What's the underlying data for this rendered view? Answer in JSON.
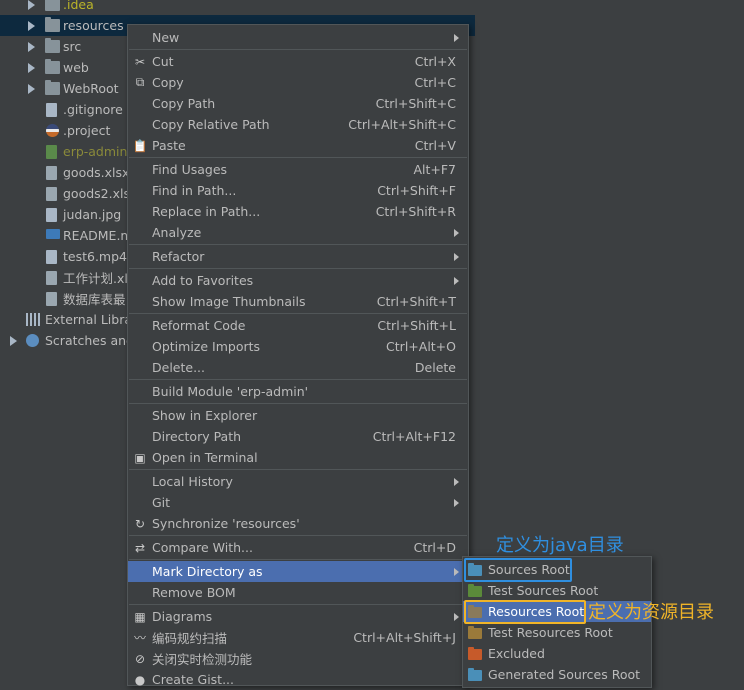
{
  "tree": [
    {
      "label": ".idea",
      "kind": "folder",
      "style": "yellow",
      "arrow": true
    },
    {
      "label": "resources",
      "kind": "folder",
      "style": "normal",
      "arrow": true,
      "selected": true
    },
    {
      "label": "src",
      "kind": "folder",
      "style": "normal",
      "arrow": true
    },
    {
      "label": "web",
      "kind": "folder",
      "style": "normal",
      "arrow": true
    },
    {
      "label": "WebRoot",
      "kind": "folder",
      "style": "normal",
      "arrow": true
    },
    {
      "label": ".gitignore",
      "kind": "file",
      "style": "normal"
    },
    {
      "label": ".project",
      "kind": "circle",
      "style": "normal"
    },
    {
      "label": "erp-admin.",
      "kind": "file-green",
      "style": "olive"
    },
    {
      "label": "goods.xlsx",
      "kind": "file-xls",
      "style": "normal"
    },
    {
      "label": "goods2.xlsx",
      "kind": "file-xls",
      "style": "normal"
    },
    {
      "label": "judan.jpg",
      "kind": "file",
      "style": "normal"
    },
    {
      "label": "README.m",
      "kind": "file-md",
      "style": "normal"
    },
    {
      "label": "test6.mp4",
      "kind": "file",
      "style": "normal"
    },
    {
      "label": "工作计划.xls",
      "kind": "file-xls",
      "style": "normal"
    },
    {
      "label": "数据库表最",
      "kind": "file-xls",
      "style": "normal"
    },
    {
      "label": "External Librar",
      "kind": "bars",
      "style": "normal",
      "top": true
    },
    {
      "label": "Scratches and",
      "kind": "scratch",
      "style": "normal",
      "top": true,
      "arrow": true
    }
  ],
  "menu": [
    {
      "label": "New",
      "shortcut": "",
      "submenu": true
    },
    {
      "sep": true
    },
    {
      "label": "Cut",
      "shortcut": "Ctrl+X",
      "icon": "✂"
    },
    {
      "label": "Copy",
      "shortcut": "Ctrl+C",
      "icon": "⧉"
    },
    {
      "label": "Copy Path",
      "shortcut": "Ctrl+Shift+C"
    },
    {
      "label": "Copy Relative Path",
      "shortcut": "Ctrl+Alt+Shift+C"
    },
    {
      "label": "Paste",
      "shortcut": "Ctrl+V",
      "icon": "📋"
    },
    {
      "sep": true
    },
    {
      "label": "Find Usages",
      "shortcut": "Alt+F7"
    },
    {
      "label": "Find in Path...",
      "shortcut": "Ctrl+Shift+F"
    },
    {
      "label": "Replace in Path...",
      "shortcut": "Ctrl+Shift+R"
    },
    {
      "label": "Analyze",
      "shortcut": "",
      "submenu": true
    },
    {
      "sep": true
    },
    {
      "label": "Refactor",
      "shortcut": "",
      "submenu": true
    },
    {
      "sep": true
    },
    {
      "label": "Add to Favorites",
      "shortcut": "",
      "submenu": true
    },
    {
      "label": "Show Image Thumbnails",
      "shortcut": "Ctrl+Shift+T"
    },
    {
      "sep": true
    },
    {
      "label": "Reformat Code",
      "shortcut": "Ctrl+Shift+L"
    },
    {
      "label": "Optimize Imports",
      "shortcut": "Ctrl+Alt+O"
    },
    {
      "label": "Delete...",
      "shortcut": "Delete"
    },
    {
      "sep": true
    },
    {
      "label": "Build Module 'erp-admin'",
      "shortcut": ""
    },
    {
      "sep": true
    },
    {
      "label": "Show in Explorer",
      "shortcut": ""
    },
    {
      "label": "Directory Path",
      "shortcut": "Ctrl+Alt+F12"
    },
    {
      "label": "Open in Terminal",
      "shortcut": "",
      "icon": "▣"
    },
    {
      "sep": true
    },
    {
      "label": "Local History",
      "shortcut": "",
      "submenu": true
    },
    {
      "label": "Git",
      "shortcut": "",
      "submenu": true
    },
    {
      "label": "Synchronize 'resources'",
      "shortcut": "",
      "icon": "↻"
    },
    {
      "sep": true
    },
    {
      "label": "Compare With...",
      "shortcut": "Ctrl+D",
      "icon": "⇄"
    },
    {
      "sep": true
    },
    {
      "label": "Mark Directory as",
      "shortcut": "",
      "submenu": true,
      "active": true
    },
    {
      "label": "Remove BOM",
      "shortcut": ""
    },
    {
      "sep": true
    },
    {
      "label": "Diagrams",
      "shortcut": "",
      "submenu": true,
      "icon": "▦"
    },
    {
      "label": "编码规约扫描",
      "shortcut": "Ctrl+Alt+Shift+J",
      "icon": "〰"
    },
    {
      "label": "关闭实时检测功能",
      "shortcut": "",
      "icon": "⊘"
    },
    {
      "label": "Create Gist...",
      "shortcut": "",
      "icon": "●"
    }
  ],
  "submenu": [
    {
      "label": "Sources Root",
      "color": "#4a8fb8"
    },
    {
      "label": "Test Sources Root",
      "color": "#5b8a3a"
    },
    {
      "label": "Resources Root",
      "color": "#8a7a5a",
      "active": true
    },
    {
      "label": "Test Resources Root",
      "color": "#9a7a3a"
    },
    {
      "label": "Excluded",
      "color": "#c65a2a"
    },
    {
      "label": "Generated Sources Root",
      "color": "#4a8fb8"
    }
  ],
  "annotations": {
    "java_label": "定义为java目录",
    "java_color": "#2f8fe0",
    "resource_label": "定义为资源目录",
    "resource_color": "#f0b428"
  }
}
